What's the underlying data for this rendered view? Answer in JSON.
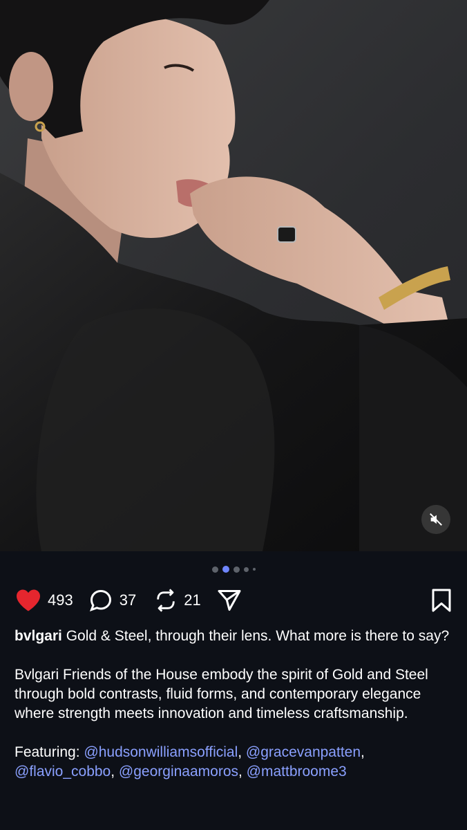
{
  "post": {
    "image_alt": "",
    "carousel": {
      "total": 5,
      "active_index": 1
    },
    "media_controls": {
      "mute_icon": "speaker-muted-icon"
    }
  },
  "actions": {
    "like": {
      "icon": "heart-icon",
      "count": "493",
      "color": "#e5262e"
    },
    "comment": {
      "icon": "comment-bubble-icon",
      "count": "37"
    },
    "repost": {
      "icon": "repost-icon",
      "count": "21"
    },
    "share": {
      "icon": "send-icon"
    },
    "save": {
      "icon": "bookmark-icon"
    }
  },
  "caption": {
    "username": "bvlgari",
    "headline": " Gold & Steel, through their lens. What more is there to say?",
    "body": "Bvlgari Friends of the House embody the spirit of Gold and Steel through bold contrasts, fluid forms, and contemporary elegance where strength meets innovation and timeless craftsmanship.",
    "featuring_label": "Featuring: ",
    "mentions": [
      "@hudsonwilliamsofficial",
      "@gracevanpatten",
      "@flavio_cobbo",
      "@georginaamoros",
      "@mattbroome3"
    ],
    "separator": ", "
  },
  "theme": {
    "background": "#0d1017",
    "mention_color": "#8aa0ff",
    "dot_active": "#6f86ff"
  }
}
